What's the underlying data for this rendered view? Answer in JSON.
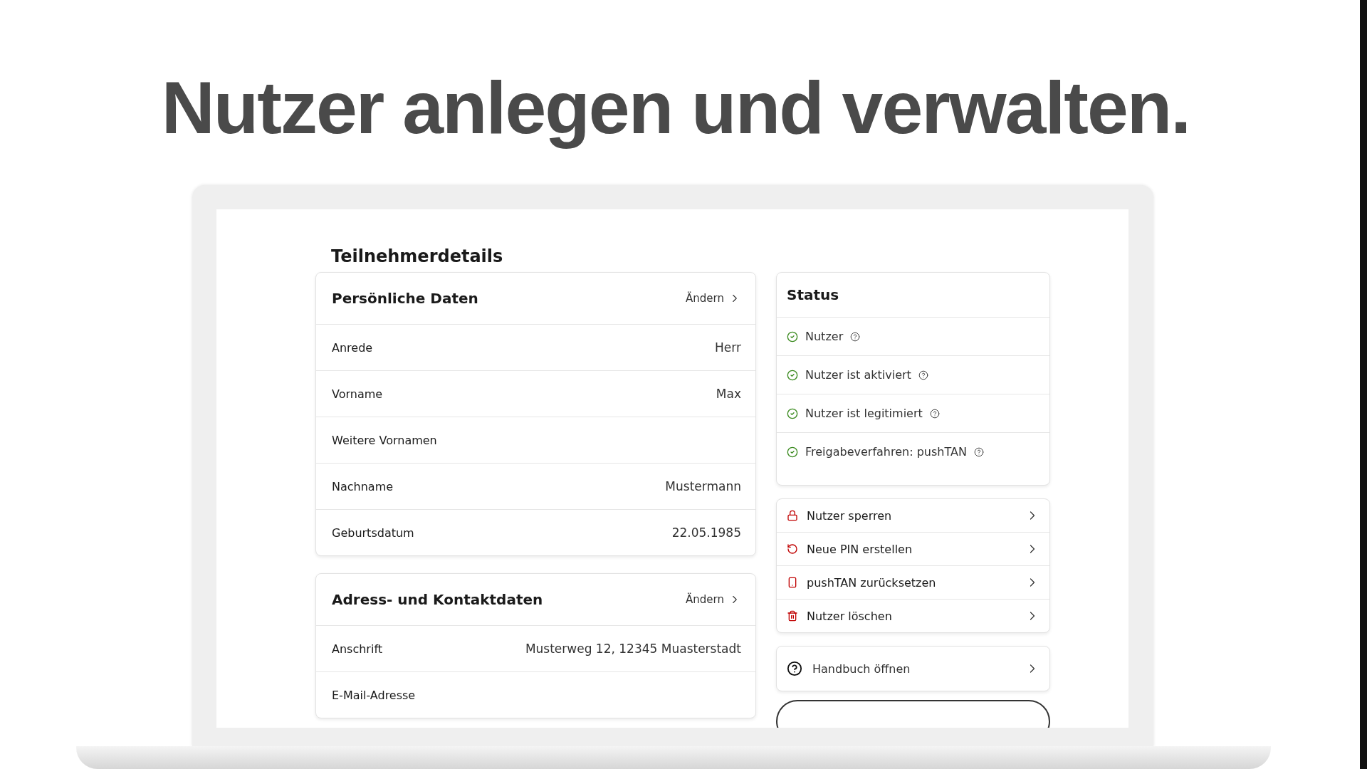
{
  "headline": "Nutzer anlegen und verwalten.",
  "page": {
    "title": "Teilnehmerdetails"
  },
  "sections": [
    {
      "title": "Persönliche Daten",
      "action": "Ändern",
      "rows": [
        {
          "label": "Anrede",
          "value": "Herr"
        },
        {
          "label": "Vorname",
          "value": "Max"
        },
        {
          "label": "Weitere Vornamen"
        },
        {
          "label": "Nachname",
          "value": "Mustermann"
        },
        {
          "label": "Geburtsdatum",
          "value": "22.05.1985"
        }
      ]
    },
    {
      "title": "Adress- und Kontaktdaten",
      "action": "Ändern",
      "rows": [
        {
          "label": "Anschrift",
          "value": "Musterweg 12, 12345 Muasterstadt"
        },
        {
          "label": "E-Mail-Adresse"
        }
      ]
    }
  ],
  "status": {
    "title": "Status",
    "items": [
      {
        "label": "Nutzer",
        "ok": true
      },
      {
        "label": "Nutzer ist aktiviert",
        "ok": true
      },
      {
        "label": "Nutzer ist legitimiert",
        "ok": true
      },
      {
        "label": "Freigabeverfahren: pushTAN",
        "ok": true
      }
    ]
  },
  "actions": [
    {
      "kind": "lock",
      "label": "Nutzer sperren"
    },
    {
      "kind": "reset",
      "label": "Neue PIN erstellen"
    },
    {
      "kind": "phone",
      "label": "pushTAN zurücksetzen"
    },
    {
      "kind": "delete",
      "label": "Nutzer löschen"
    }
  ],
  "help": {
    "label": "Handbuch öffnen"
  }
}
